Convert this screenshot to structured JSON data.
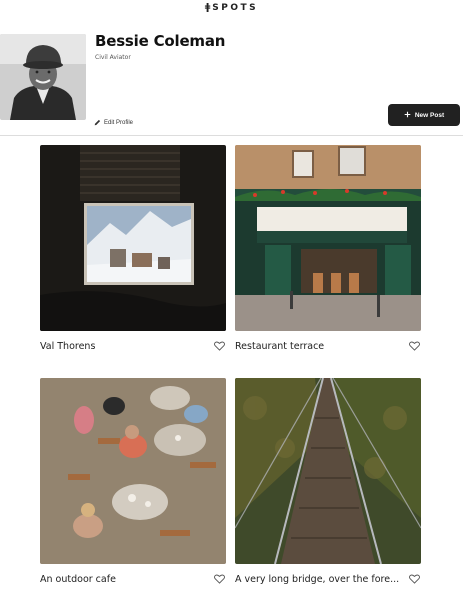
{
  "app": {
    "logo_text": "SPOTS",
    "logo_mark": "ǂ"
  },
  "profile": {
    "name": "Bessie Coleman",
    "description": "Civil Aviator",
    "edit_label": "Edit Profile",
    "avatar_icon": "avatar-photo"
  },
  "actions": {
    "new_post_label": "New Post"
  },
  "cards": [
    {
      "title": "Val Thorens",
      "liked": false
    },
    {
      "title": "Restaurant terrace",
      "liked": false
    },
    {
      "title": "An outdoor cafe",
      "liked": false
    },
    {
      "title": "A very long bridge, over the fore...",
      "liked": false
    }
  ],
  "colors": {
    "primary": "#212121",
    "text_secondary": "#555555",
    "divider": "#dddddd"
  }
}
